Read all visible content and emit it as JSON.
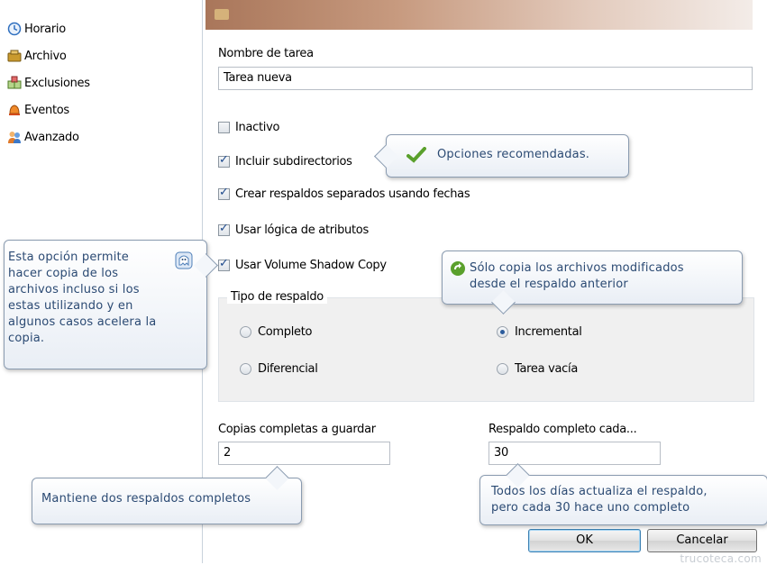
{
  "sidebar": {
    "items": [
      {
        "label": "Horario",
        "icon": "clock-icon"
      },
      {
        "label": "Archivo",
        "icon": "archive-icon"
      },
      {
        "label": "Exclusiones",
        "icon": "exclusions-icon"
      },
      {
        "label": "Eventos",
        "icon": "bell-icon"
      },
      {
        "label": "Avanzado",
        "icon": "advanced-users-icon"
      }
    ]
  },
  "task": {
    "name_label": "Nombre de tarea",
    "name_value": "Tarea nueva"
  },
  "options": {
    "inactive": {
      "label": "Inactivo",
      "checked": false
    },
    "include_subdirs": {
      "label": "Incluir subdirectorios",
      "checked": true
    },
    "separate_dated": {
      "label": "Crear respaldos separados usando fechas",
      "checked": true
    },
    "attribute_logic": {
      "label": "Usar lógica de atributos",
      "checked": true
    },
    "volume_shadow": {
      "label": "Usar Volume Shadow Copy",
      "checked": true
    }
  },
  "backup_type": {
    "title": "Tipo de respaldo",
    "options": [
      {
        "label": "Completo",
        "selected": false
      },
      {
        "label": "Incremental",
        "selected": true
      },
      {
        "label": "Diferencial",
        "selected": false
      },
      {
        "label": "Tarea vacía",
        "selected": false
      }
    ]
  },
  "full_copies": {
    "label": "Copias completas a guardar",
    "value": "2"
  },
  "full_every": {
    "label": "Respaldo completo cada...",
    "value": "30"
  },
  "buttons": {
    "ok": "OK",
    "cancel": "Cancelar"
  },
  "tooltips": {
    "recommended": "Opciones recomendadas.",
    "vss_lines": [
      "Esta opción permite",
      "hacer copia de los",
      "archivos incluso si los",
      "estas utilizando y en",
      "algunos casos acelera la",
      "copia."
    ],
    "incremental_lines": [
      "Sólo copia los archivos modificados",
      "desde el respaldo anterior"
    ],
    "keep_two": "Mantiene dos respaldos completos",
    "every30_lines": [
      "Todos los días actualiza el respaldo,",
      "pero cada 30 hace uno completo"
    ]
  },
  "watermark": "trucoteca.com",
  "colors": {
    "tooltip_text": "#2b4a73",
    "check_green": "#5aa02c",
    "header_band": "#a9765a"
  }
}
